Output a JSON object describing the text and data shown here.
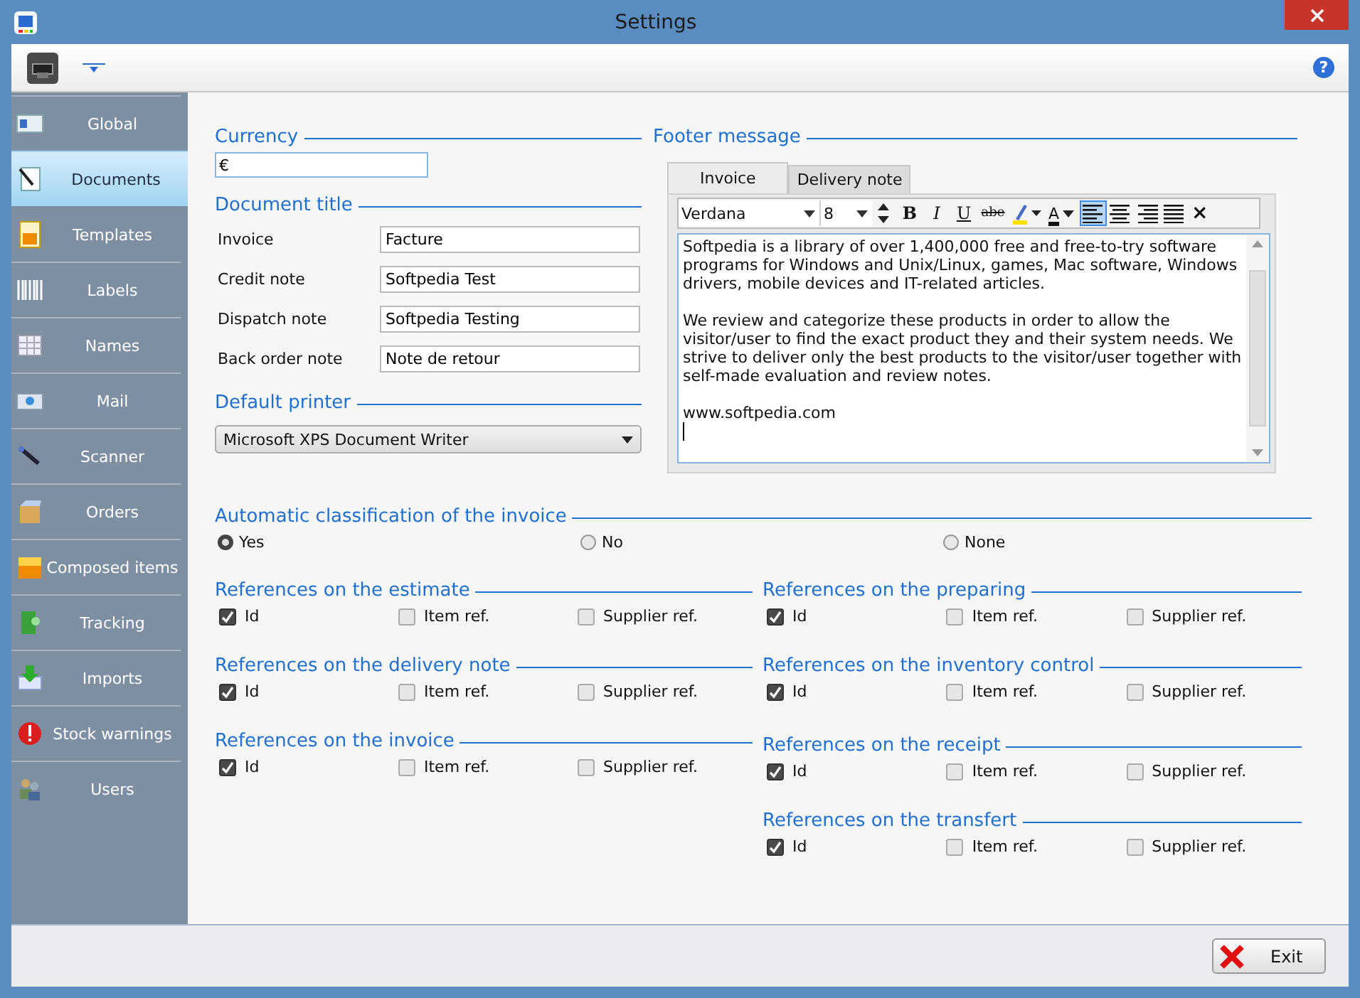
{
  "window": {
    "title": "Settings"
  },
  "toolbar": {
    "help": "?"
  },
  "sidebar": {
    "items": [
      {
        "label": "Global",
        "selected": false
      },
      {
        "label": "Documents",
        "selected": true
      },
      {
        "label": "Templates",
        "selected": false
      },
      {
        "label": "Labels",
        "selected": false
      },
      {
        "label": "Names",
        "selected": false
      },
      {
        "label": "Mail",
        "selected": false
      },
      {
        "label": "Scanner",
        "selected": false
      },
      {
        "label": "Orders",
        "selected": false
      },
      {
        "label": "Composed items",
        "selected": false
      },
      {
        "label": "Tracking",
        "selected": false
      },
      {
        "label": "Imports",
        "selected": false
      },
      {
        "label": "Stock warnings",
        "selected": false
      },
      {
        "label": "Users",
        "selected": false
      }
    ]
  },
  "currency": {
    "label": "Currency",
    "value": "€"
  },
  "document_title": {
    "label": "Document title",
    "rows": [
      {
        "label": "Invoice",
        "value": "Facture"
      },
      {
        "label": "Credit note",
        "value": "Softpedia Test"
      },
      {
        "label": "Dispatch note",
        "value": "Softpedia Testing"
      },
      {
        "label": "Back order note",
        "value": "Note de retour"
      }
    ]
  },
  "default_printer": {
    "label": "Default printer",
    "value": "Microsoft XPS Document Writer"
  },
  "footer_message": {
    "label": "Footer message",
    "tabs": [
      {
        "label": "Invoice",
        "selected": true
      },
      {
        "label": "Delivery note",
        "selected": false
      }
    ],
    "font": "Verdana",
    "size": "8",
    "format_buttons": [
      {
        "kind": "bold",
        "label": "B"
      },
      {
        "kind": "italic",
        "label": "I"
      },
      {
        "kind": "underline",
        "label": "U"
      },
      {
        "kind": "strike",
        "label": "abe"
      }
    ],
    "text_color_label": "A",
    "align": [
      {
        "kind": "left",
        "selected": true
      },
      {
        "kind": "center",
        "selected": false
      },
      {
        "kind": "right",
        "selected": false
      },
      {
        "kind": "justify",
        "selected": false
      }
    ],
    "close": "×",
    "paragraphs": [
      "Softpedia is a library of over 1,400,000 free and free-to-try software programs for Windows and Unix/Linux, games, Mac software, Windows drivers, mobile devices and IT-related articles.",
      "We review and categorize these products in order to allow the visitor/user to find the exact product they and their system needs. We strive to deliver only the best products to the visitor/user together with self-made evaluation and review notes.",
      "www.softpedia.com"
    ]
  },
  "classification": {
    "label": "Automatic classification of the invoice",
    "options": [
      {
        "label": "Yes",
        "selected": true
      },
      {
        "label": "No",
        "selected": false
      },
      {
        "label": "None",
        "selected": false
      }
    ]
  },
  "references": {
    "left": [
      {
        "title": "References on the estimate",
        "options": [
          {
            "label": "Id",
            "checked": true
          },
          {
            "label": "Item ref.",
            "checked": false
          },
          {
            "label": "Supplier ref.",
            "checked": false
          }
        ]
      },
      {
        "title": "References on the delivery note",
        "options": [
          {
            "label": "Id",
            "checked": true
          },
          {
            "label": "Item ref.",
            "checked": false
          },
          {
            "label": "Supplier ref.",
            "checked": false
          }
        ]
      },
      {
        "title": "References on the invoice",
        "options": [
          {
            "label": "Id",
            "checked": true
          },
          {
            "label": "Item ref.",
            "checked": false
          },
          {
            "label": "Supplier ref.",
            "checked": false
          }
        ]
      }
    ],
    "right": [
      {
        "title": "References on the preparing",
        "options": [
          {
            "label": "Id",
            "checked": true
          },
          {
            "label": "Item ref.",
            "checked": false
          },
          {
            "label": "Supplier ref.",
            "checked": false
          }
        ]
      },
      {
        "title": "References on the inventory control",
        "options": [
          {
            "label": "Id",
            "checked": true
          },
          {
            "label": "Item ref.",
            "checked": false
          },
          {
            "label": "Supplier ref.",
            "checked": false
          }
        ]
      },
      {
        "title": "References on the receipt",
        "options": [
          {
            "label": "Id",
            "checked": true
          },
          {
            "label": "Item ref.",
            "checked": false
          },
          {
            "label": "Supplier ref.",
            "checked": false
          }
        ]
      },
      {
        "title": "References on the transfert",
        "options": [
          {
            "label": "Id",
            "checked": true
          },
          {
            "label": "Item ref.",
            "checked": false
          },
          {
            "label": "Supplier ref.",
            "checked": false
          }
        ]
      }
    ]
  },
  "exit_button": {
    "label": "Exit"
  }
}
